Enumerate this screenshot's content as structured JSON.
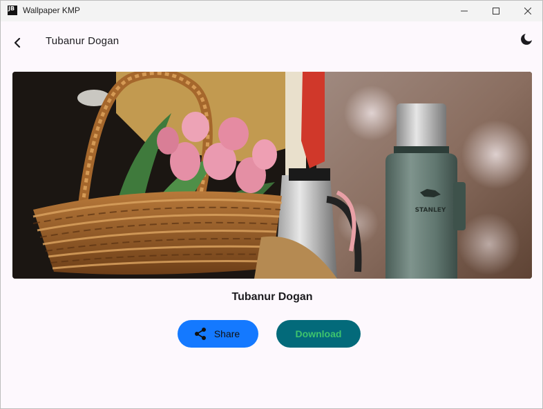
{
  "window": {
    "title": "Wallpaper KMP",
    "app_icon_text": "JB"
  },
  "header": {
    "title": "Tubanur Dogan",
    "back_icon": "arrow-back-icon",
    "theme_icon": "moon-icon"
  },
  "wallpaper": {
    "alt": "Wicker basket with pink tulips next to a green Stanley thermos",
    "bottle_text": "STANLEY"
  },
  "author": {
    "name": "Tubanur Dogan"
  },
  "actions": {
    "share_label": "Share",
    "share_icon": "share-icon",
    "download_label": "Download"
  },
  "colors": {
    "share_button": "#1479ff",
    "download_button": "#036a7a",
    "download_text": "#3ec46d",
    "background": "#fdf8fd"
  }
}
